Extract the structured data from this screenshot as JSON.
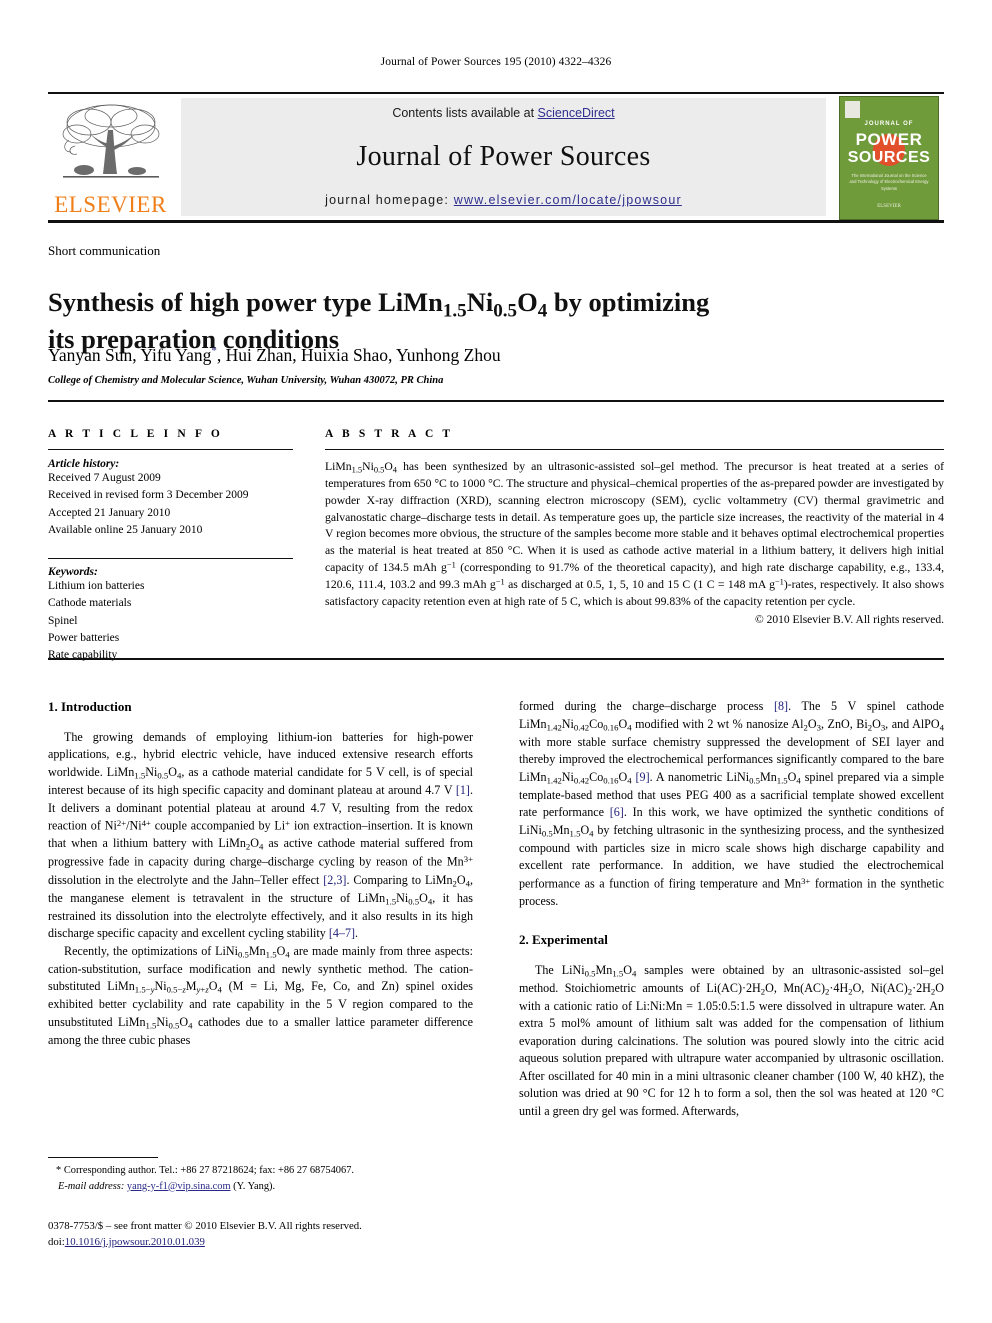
{
  "running_head": "Journal of Power Sources 195 (2010) 4322–4326",
  "masthead": {
    "publisher_name": "ELSEVIER",
    "contents_prefix": "Contents lists available at ",
    "contents_link": "ScienceDirect",
    "journal_title": "Journal of Power Sources",
    "homepage_prefix": "journal homepage: ",
    "homepage_url": "www.elsevier.com/locate/jpowsour",
    "cover": {
      "journal_of": "JOURNAL OF",
      "power": "POWER",
      "sources": "SOURCES",
      "subtitle": "The International Journal on the Science and Technology of Electrochemical Energy Systems",
      "footer": "ELSEVIER"
    }
  },
  "article": {
    "doctype": "Short communication",
    "title_line1_pre": "Synthesis of high power type LiMn",
    "title_sub1": "1.5",
    "title_mid": "Ni",
    "title_sub2": "0.5",
    "title_mid2": "O",
    "title_sub3": "4",
    "title_line1_post": " by optimizing",
    "title_line2": "its preparation conditions",
    "title_plain": "Synthesis of high power type LiMn1.5Ni0.5O4 by optimizing its preparation conditions",
    "authors": "Yanyan Sun, Yifu Yang*, Hui Zhan, Huixia Shao, Yunhong Zhou",
    "affiliation": "College of Chemistry and Molecular Science, Wuhan University, Wuhan 430072, PR China"
  },
  "article_info": {
    "heading": "A R T I C L E   I N F O",
    "history_label": "Article history:",
    "history": [
      "Received 7 August 2009",
      "Received in revised form 3 December 2009",
      "Accepted 21 January 2010",
      "Available online 25 January 2010"
    ],
    "keywords_label": "Keywords:",
    "keywords": [
      "Lithium ion batteries",
      "Cathode materials",
      "Spinel",
      "Power batteries",
      "Rate capability"
    ]
  },
  "abstract": {
    "heading": "A B S T R A C T",
    "text": "has been synthesized by an ultrasonic-assisted sol–gel method. The precursor is heat treated at a series of temperatures from 650 °C to 1000 °C. The structure and physical–chemical properties of the as-prepared powder are investigated by powder X-ray diffraction (XRD), scanning electron microscopy (SEM), cyclic voltammetry (CV) thermal gravimetric and galvanostatic charge–discharge tests in detail. As temperature goes up, the particle size increases, the reactivity of the material in 4 V region becomes more obvious, the structure of the samples become more stable and it behaves optimal electrochemical properties as the material is heat treated at 850 °C. When it is used as cathode active material in a lithium battery, it delivers high initial capacity of 134.5 mAh g−1 (corresponding to 91.7% of the theoretical capacity), and high rate discharge capability, e.g., 133.4, 120.6, 111.4, 103.2 and 99.3 mAh g−1 as discharged at 0.5, 1, 5, 10 and 15 C (1 C = 148 mA g−1)-rates, respectively. It also shows satisfactory capacity retention even at high rate of 5 C, which is about 99.83% of the capacity retention per cycle.",
    "copyright": "© 2010 Elsevier B.V. All rights reserved."
  },
  "sections": {
    "introduction_heading": "1.  Introduction",
    "experimental_heading": "2.  Experimental"
  },
  "body": {
    "intro_p1": "The growing demands of employing lithium-ion batteries for high-power applications, e.g., hybrid electric vehicle, have induced extensive research efforts worldwide. LiMn1.5Ni0.5O4, as a cathode material candidate for 5 V cell, is of special interest because of its high specific capacity and dominant plateau at around 4.7 V [1]. It delivers a dominant potential plateau at around 4.7 V, resulting from the redox reaction of Ni2+/Ni4+ couple accompanied by Li+ ion extraction–insertion. It is known that when a lithium battery with LiMn2O4 as active cathode material suffered from progressive fade in capacity during charge–discharge cycling by reason of the Mn3+ dissolution in the electrolyte and the Jahn–Teller effect [2,3]. Comparing to LiMn2O4, the manganese element is tetravalent in the structure of LiMn1.5Ni0.5O4, it has restrained its dissolution into the electrolyte effectively, and it also results in its high discharge specific capacity and excellent cycling stability [4–7].",
    "intro_p2": "Recently, the optimizations of LiNi0.5Mn1.5O4 are made mainly from three aspects: cation-substitution, surface modification and newly synthetic method. The cation-substituted LiMn1.5−yNi0.5−zMy+zO4 (M = Li, Mg, Fe, Co, and Zn) spinel oxides exhibited better cyclability and rate capability in the 5 V region compared to the unsubstituted LiMn1.5Ni0.5O4 cathodes due to a smaller lattice parameter difference among the three cubic phases formed during the charge–discharge process [8]. The 5 V spinel cathode LiMn1.42Ni0.42Co0.16O4 modified with 2 wt % nanosize Al2O3, ZnO, Bi2O3, and AlPO4 with more stable surface chemistry suppressed the development of SEI layer and thereby improved the electrochemical performances significantly compared to the bare LiMn1.42Ni0.42Co0.16O4 [9]. A nanometric LiNi0.5Mn1.5O4 spinel prepared via a simple template-based method that uses PEG 400 as a sacrificial template showed excellent rate performance [6]. In this work, we have optimized the synthetic conditions of LiNi0.5Mn1.5O4 by fetching ultrasonic in the synthesizing process, and the synthesized compound with particles size in micro scale shows high discharge capability and excellent rate performance. In addition, we have studied the electrochemical performance as a function of firing temperature and Mn3+ formation in the synthetic process.",
    "exp_p1": "The LiNi0.5Mn1.5O4 samples were obtained by an ultrasonic-assisted sol–gel method. Stoichiometric amounts of Li(AC)·2H2O, Mn(AC)2·4H2O, Ni(AC)2·2H2O with a cationic ratio of Li:Ni:Mn = 1.05:0.5:1.5 were dissolved in ultrapure water. An extra 5 mol% amount of lithium salt was added for the compensation of lithium evaporation during calcinations. The solution was poured slowly into the citric acid aqueous solution prepared with ultrapure water accompanied by ultrasonic oscillation. After oscillated for 40 min in a mini ultrasonic cleaner chamber (100 W, 40 kHZ), the solution was dried at 90 °C for 12 h to form a sol, then the sol was heated at 120 °C until a green dry gel was formed. Afterwards,"
  },
  "footnote": {
    "star": "*",
    "corresponding": "Corresponding author. Tel.: +86 27 87218624; fax: +86 27 68754067.",
    "email_label": "E-mail address:",
    "email": "yang-y-f1@vip.sina.com",
    "email_suffix": "(Y. Yang)."
  },
  "footer": {
    "issn_line": "0378-7753/$ – see front matter © 2010 Elsevier B.V. All rights reserved.",
    "doi_label": "doi:",
    "doi": "10.1016/j.jpowsour.2010.01.039"
  },
  "colors": {
    "elsevier_orange": "#F07F1A",
    "link_blue": "#2f2f8f",
    "reference_blue": "#1f1f7a",
    "cover_green": "#6f9b3a",
    "cover_circle": "#e1502a",
    "band_gray": "#ececed"
  }
}
